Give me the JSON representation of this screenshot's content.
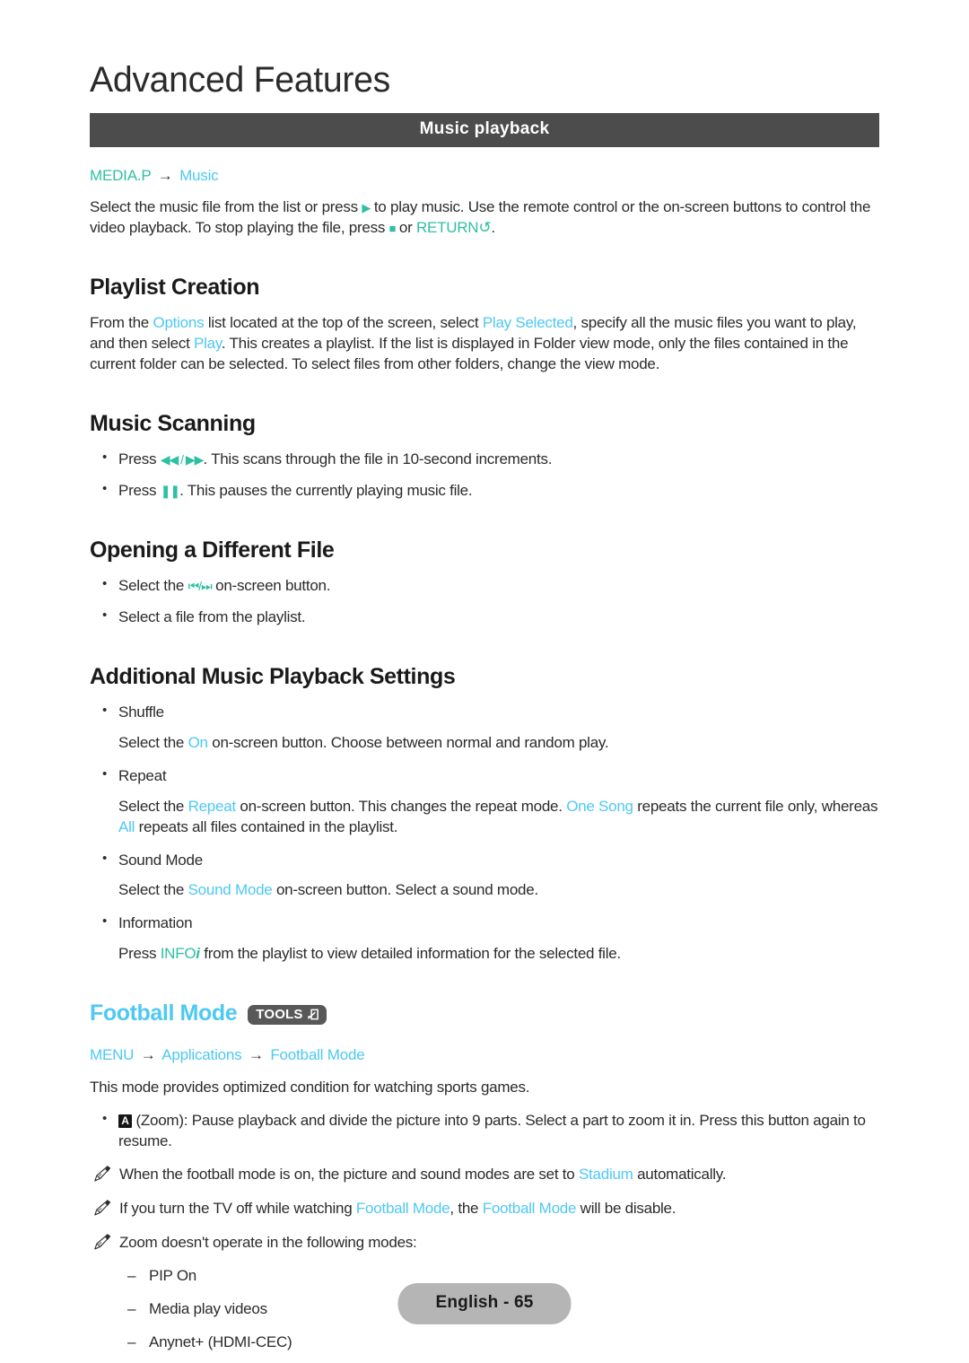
{
  "chapter": {
    "title": "Advanced Features"
  },
  "banner": {
    "label": "Music playback"
  },
  "intro_path": {
    "first": "MEDIA.P",
    "arrow": "→",
    "second": "Music"
  },
  "intro_paragraph": {
    "part1": "Select the music file from the list or press ",
    "play_glyph": "▶",
    "part2": " to play music. Use the remote control or the on-screen buttons to control the video playback. To stop playing the file, press ",
    "stop_glyph": "■",
    "part3": " or ",
    "return_label": "RETURN",
    "return_glyph": "↺",
    "part4": "."
  },
  "playlist_creation": {
    "heading": "Playlist Creation",
    "p_a": "From the ",
    "link_options": "Options",
    "p_b": " list located at the top of the screen, select ",
    "link_play_selected": "Play Selected",
    "p_c": ", specify all the music files you want to play, and then select ",
    "link_play": "Play",
    "p_d": ". This creates a playlist. If the list is displayed in Folder view mode, only the files contained in the current folder can be selected. To select files from other folders, change the view mode."
  },
  "music_scanning": {
    "heading": "Music Scanning",
    "items": [
      {
        "pre": "Press ",
        "glyph": "◀◀ / ▶▶",
        "post": ". This scans through the file in 10-second increments."
      },
      {
        "pre": "Press ",
        "glyph": "❚❚",
        "post": ". This pauses the currently playing music file."
      }
    ]
  },
  "opening_different_file": {
    "heading": "Opening a Different File",
    "items": [
      {
        "pre": "Select the ",
        "glyph": "⏮/⏭",
        "post": " on-screen button."
      },
      {
        "pre": "Select a file from the playlist.",
        "glyph": "",
        "post": ""
      }
    ]
  },
  "additional_settings": {
    "heading": "Additional Music Playback Settings",
    "entries": [
      {
        "label": "Shuffle",
        "body_a": "Select the ",
        "link_1": "On",
        "body_b": " on-screen button. Choose between normal and random play.",
        "link_2": "",
        "body_c": "",
        "link_3": "",
        "body_d": ""
      },
      {
        "label": "Repeat",
        "body_a": "Select the ",
        "link_1": "Repeat",
        "body_b": " on-screen button. This changes the repeat mode. ",
        "link_2": "One Song",
        "body_c": " repeats the current file only, whereas ",
        "link_3": "All",
        "body_d": " repeats all files contained in the playlist."
      },
      {
        "label": "Sound Mode",
        "body_a": "Select the ",
        "link_1": "Sound Mode",
        "body_b": " on-screen button. Select a sound mode.",
        "link_2": "",
        "body_c": "",
        "link_3": "",
        "body_d": ""
      },
      {
        "label": "Information",
        "body_a": "Press ",
        "link_1": "INFO",
        "body_b": " from the playlist to view detailed information for the selected file.",
        "link_2": "",
        "body_c": "",
        "link_3": "",
        "body_d": ""
      }
    ],
    "info_italic": "i"
  },
  "football_mode": {
    "heading": "Football Mode",
    "tools_badge_label": "TOOLS",
    "path": {
      "first": "MENU",
      "arrow1": "→",
      "second": "Applications",
      "arrow2": "→",
      "third": "Football Mode"
    },
    "intro": "This mode provides optimized condition for watching sports games.",
    "zoom_bullet": {
      "key": "A",
      "text": " (Zoom): Pause playback and divide the picture into 9 parts. Select a part to zoom it in. Press this button again to resume."
    },
    "notes": [
      {
        "a": "When the football mode is on, the picture and sound modes are set to ",
        "link1": "Stadium",
        "b": " automatically.",
        "link2": "",
        "c": ""
      },
      {
        "a": "If you turn the TV off while watching ",
        "link1": "Football Mode",
        "b": ", the ",
        "link2": "Football Mode",
        "c": " will be disable."
      },
      {
        "a": "Zoom doesn't operate in the following modes:",
        "link1": "",
        "b": "",
        "link2": "",
        "c": ""
      }
    ],
    "excluded_modes": [
      "PIP On",
      "Media play videos",
      "Anynet+ (HDMI-CEC)"
    ]
  },
  "footer": {
    "page_label": "English - 65"
  },
  "colors": {
    "cyan": "#4ec8f4",
    "teal": "#2fbfa4",
    "banner_bg": "#4c4c4c",
    "badge_bg": "#585858",
    "footer_bg": "#b5b5b5"
  }
}
